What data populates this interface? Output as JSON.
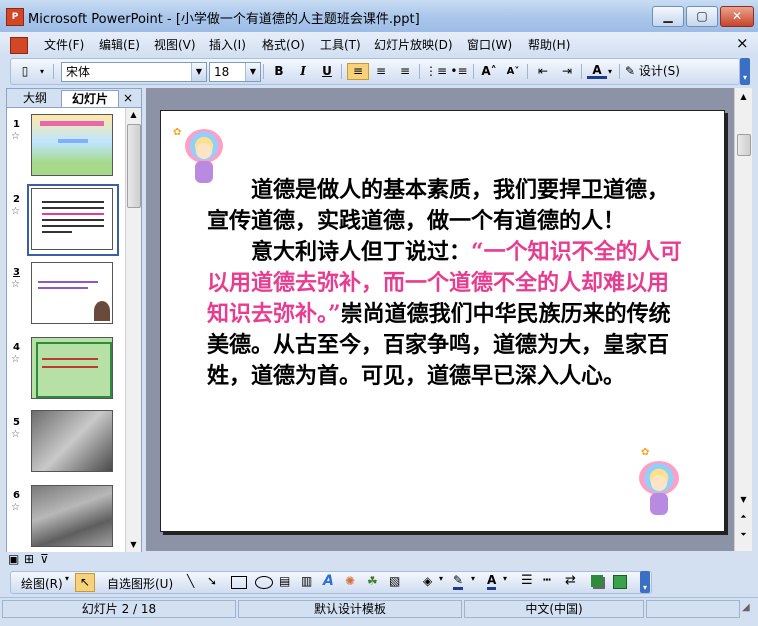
{
  "window": {
    "title": "Microsoft PowerPoint - [小学做一个有道德的人主题班会课件.ppt]",
    "app_icon": "powerpoint-icon",
    "minimize_icon": "minimize-icon",
    "maximize_icon": "maximize-icon",
    "close_icon": "close-icon"
  },
  "menu": {
    "items": [
      {
        "label": "文件(F)"
      },
      {
        "label": "编辑(E)"
      },
      {
        "label": "视图(V)"
      },
      {
        "label": "插入(I)"
      },
      {
        "label": "格式(O)"
      },
      {
        "label": "工具(T)"
      },
      {
        "label": "幻灯片放映(D)"
      },
      {
        "label": "窗口(W)"
      },
      {
        "label": "帮助(H)"
      }
    ],
    "close_label": "×"
  },
  "toolbar": {
    "font_name": "宋体",
    "font_size": "18",
    "bold": "B",
    "italic": "I",
    "underline": "U",
    "design_label": "设计(S)",
    "font_color_label": "A"
  },
  "left_pane": {
    "tab_outline": "大纲",
    "tab_slides": "幻灯片",
    "tab_close": "×",
    "slides": [
      {
        "number": "1"
      },
      {
        "number": "2"
      },
      {
        "number": "3"
      },
      {
        "number": "4"
      },
      {
        "number": "5"
      },
      {
        "number": "6"
      }
    ],
    "star": "☆"
  },
  "slide": {
    "para1": "道德是做人的基本素质，我们要捍卫道德，宣传道德，实践道德，做一个有道德的人！",
    "para2_intro": "意大利诗人但丁说过：",
    "para2_quote": "“一个知识不全的人可以用道德去弥补，而一个道德不全的人却难以用知识去弥补。”",
    "para2_rest": "崇尚道德我们中华民族历来的传统美德。从古至今，百家争鸣，道德为大，皇家百姓，道德为首。可见，道德早已深入人心。",
    "quote_color": "#e73c8f"
  },
  "drawbar": {
    "draw_label": "绘图(R)",
    "autoshape_label": "自选图形(U)"
  },
  "status": {
    "slide_info": "幻灯片 2 / 18",
    "template": "默认设计模板",
    "language": "中文(中国)"
  }
}
